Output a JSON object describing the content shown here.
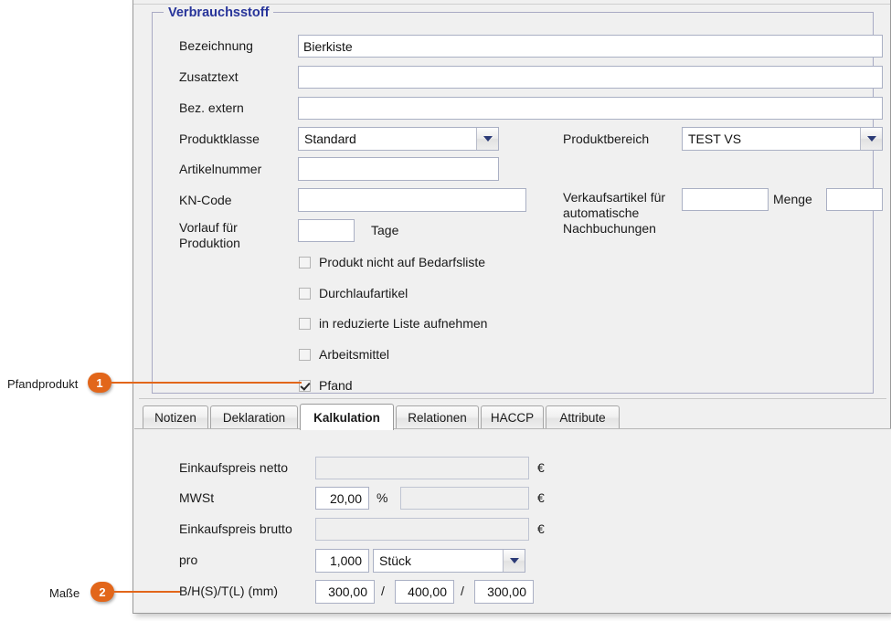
{
  "groupbox": {
    "title": "Verbrauchsstoff"
  },
  "form": {
    "bezeichnung_label": "Bezeichnung",
    "bezeichnung_value": "Bierkiste",
    "zusatztext_label": "Zusatztext",
    "zusatztext_value": "",
    "bez_extern_label": "Bez. extern",
    "bez_extern_value": "",
    "produktklasse_label": "Produktklasse",
    "produktklasse_value": "Standard",
    "produktbereich_label": "Produktbereich",
    "produktbereich_value": "TEST VS",
    "artikelnummer_label": "Artikelnummer",
    "artikelnummer_value": "",
    "kncode_label": "KN-Code",
    "kncode_value": "",
    "verkaufsartikel_label": "Verkaufsartikel für automatische Nachbuchungen",
    "verkaufsartikel_value": "",
    "menge_label": "Menge",
    "menge_value": "",
    "vorlauf_label": "Vorlauf für Produktion",
    "vorlauf_value": "",
    "tage_label": "Tage"
  },
  "checkboxes": [
    {
      "label": "Produkt nicht auf Bedarfsliste",
      "checked": false
    },
    {
      "label": "Durchlaufartikel",
      "checked": false
    },
    {
      "label": "in reduzierte Liste aufnehmen",
      "checked": false
    },
    {
      "label": "Arbeitsmittel",
      "checked": false
    },
    {
      "label": "Pfand",
      "checked": true
    }
  ],
  "tabs": [
    {
      "label": "Notizen",
      "active": false
    },
    {
      "label": "Deklaration",
      "active": false
    },
    {
      "label": "Kalkulation",
      "active": true
    },
    {
      "label": "Relationen",
      "active": false
    },
    {
      "label": "HACCP",
      "active": false
    },
    {
      "label": "Attribute",
      "active": false
    }
  ],
  "kalkulation": {
    "ek_netto_label": "Einkaufspreis netto",
    "ek_netto_value": "",
    "ek_netto_unit": "€",
    "mwst_label": "MWSt",
    "mwst_value": "20,00",
    "mwst_percent": "%",
    "mwst_amount": "",
    "mwst_unit": "€",
    "ek_brutto_label": "Einkaufspreis brutto",
    "ek_brutto_value": "",
    "ek_brutto_unit": "€",
    "pro_label": "pro",
    "pro_value": "1,000",
    "pro_unit": "Stück",
    "dimension_label": "B/H(S)/T(L) (mm)",
    "dim_b": "300,00",
    "dim_h": "400,00",
    "dim_t": "300,00",
    "dim_sep1": "/",
    "dim_sep2": "/"
  },
  "callouts": [
    {
      "number": "1",
      "text": "Pfandprodukt"
    },
    {
      "number": "2",
      "text": "Maße"
    }
  ],
  "colors": {
    "accent": "#e2661a",
    "groupbox_title": "#27349a",
    "panel_bg": "#f0f0f0",
    "field_border": "#aab0c4"
  }
}
